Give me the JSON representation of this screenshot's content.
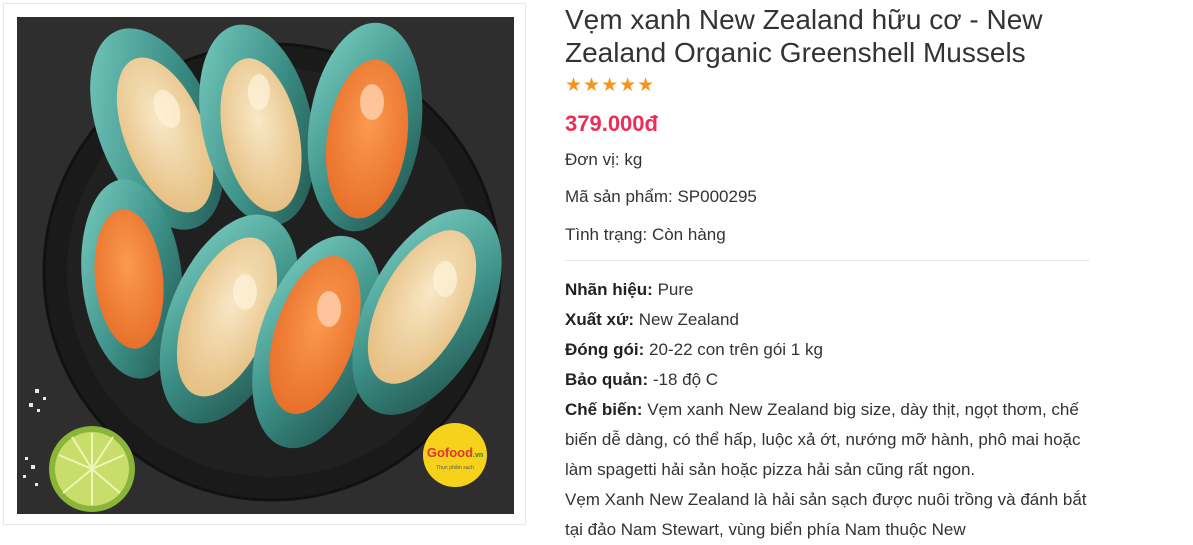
{
  "product": {
    "title": "Vẹm xanh New Zealand hữu cơ - New Zealand Organic Greenshell Mussels",
    "rating_stars": "★★★★★",
    "rating": 5,
    "price": "379.000đ",
    "unit_label": "Đơn vị:",
    "unit_value": "kg",
    "sku_label": "Mã sản phẩm:",
    "sku_value": "SP000295",
    "status_label": "Tình trạng:",
    "status_value": "Còn hàng"
  },
  "details": {
    "brand_label": "Nhãn hiệu:",
    "brand_value": "Pure",
    "origin_label": "Xuất xứ:",
    "origin_value": "New Zealand",
    "pack_label": "Đóng gói:",
    "pack_value": "20-22 con trên gói 1 kg",
    "storage_label": "Bảo quản:",
    "storage_value": "-18 độ C",
    "process_label": "Chế biến:",
    "process_value": "Vẹm xanh New Zealand big size, dày thịt, ngọt thơm, chế biến dễ dàng, có thể hấp, luộc xả ớt, nướng mỡ hành, phô mai hoặc làm spagetti hải sản hoặc pizza hải sản cũng rất ngon.",
    "extra_text": "Vẹm Xanh New Zealand là hải sản sạch được nuôi trồng và đánh bắt tại đảo Nam Stewart, vùng biển phía Nam thuộc New"
  },
  "image": {
    "logo_text": "Gofood",
    "logo_suffix": ".vn",
    "logo_tagline": "Thực phẩm sạch",
    "colors": {
      "background": "#2e2e2f",
      "plate": "#1c1c1d",
      "shell": "#4fa79b",
      "meat_cream": "#f1d6a6",
      "meat_orange": "#f08a3c",
      "logo": "#f7d21b",
      "logo_red": "#e0352b"
    }
  },
  "colors": {
    "price": "#ee2d56",
    "stars": "#f7941d"
  }
}
